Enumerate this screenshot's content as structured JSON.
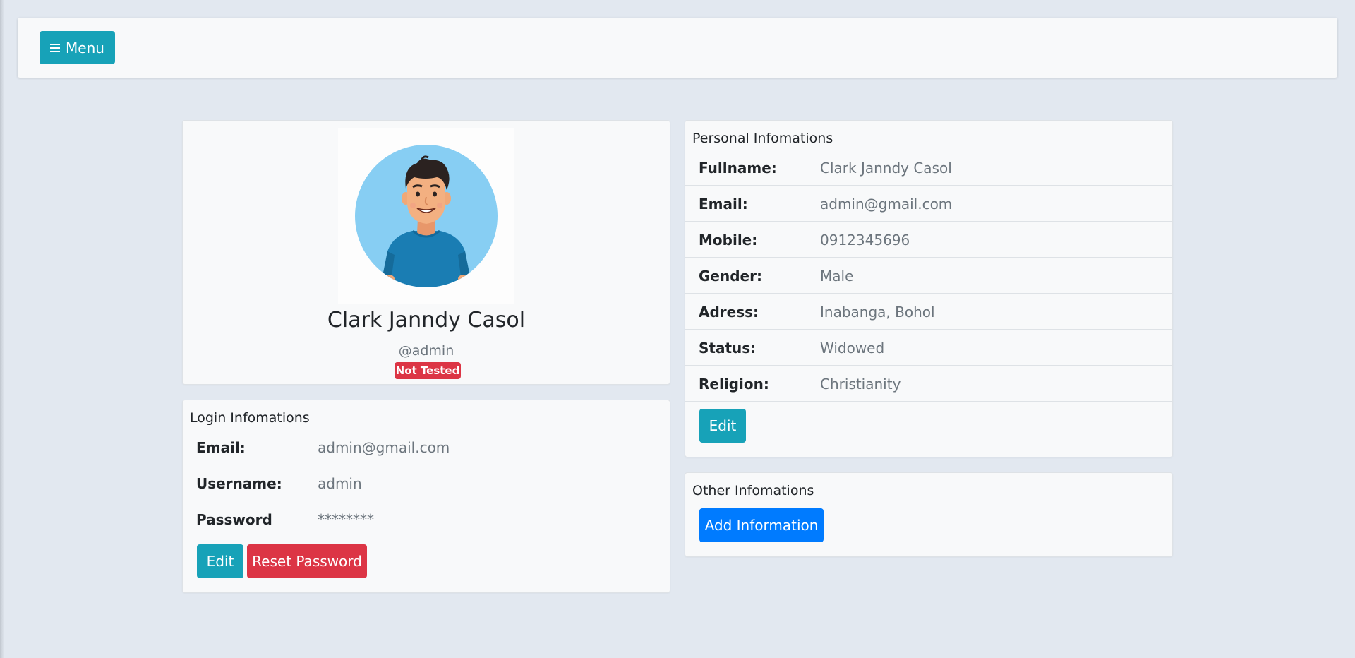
{
  "menu": {
    "label": "Menu",
    "icon": "hamburger-icon"
  },
  "profile": {
    "name": "Clark Janndy Casol",
    "username": "@admin",
    "badge": "Not Tested",
    "badge_color": "#dc3545"
  },
  "login": {
    "title": "Login Infomations",
    "rows": [
      {
        "key": "Email:",
        "value": "admin@gmail.com"
      },
      {
        "key": "Username:",
        "value": "admin"
      },
      {
        "key": "Password",
        "value": "********"
      }
    ],
    "edit_label": "Edit",
    "reset_label": "Reset Password"
  },
  "personal": {
    "title": "Personal Infomations",
    "rows": [
      {
        "key": "Fullname:",
        "value": "Clark Janndy Casol"
      },
      {
        "key": "Email:",
        "value": "admin@gmail.com"
      },
      {
        "key": "Mobile:",
        "value": "0912345696"
      },
      {
        "key": "Gender:",
        "value": "Male"
      },
      {
        "key": "Adress:",
        "value": "Inabanga, Bohol"
      },
      {
        "key": "Status:",
        "value": "Widowed"
      },
      {
        "key": "Religion:",
        "value": "Christianity"
      }
    ],
    "edit_label": "Edit"
  },
  "other": {
    "title": "Other Infomations",
    "add_label": "Add Information"
  },
  "colors": {
    "background": "#e2e8f0",
    "info": "#17a2b8",
    "danger": "#dc3545",
    "primary": "#007bff"
  }
}
